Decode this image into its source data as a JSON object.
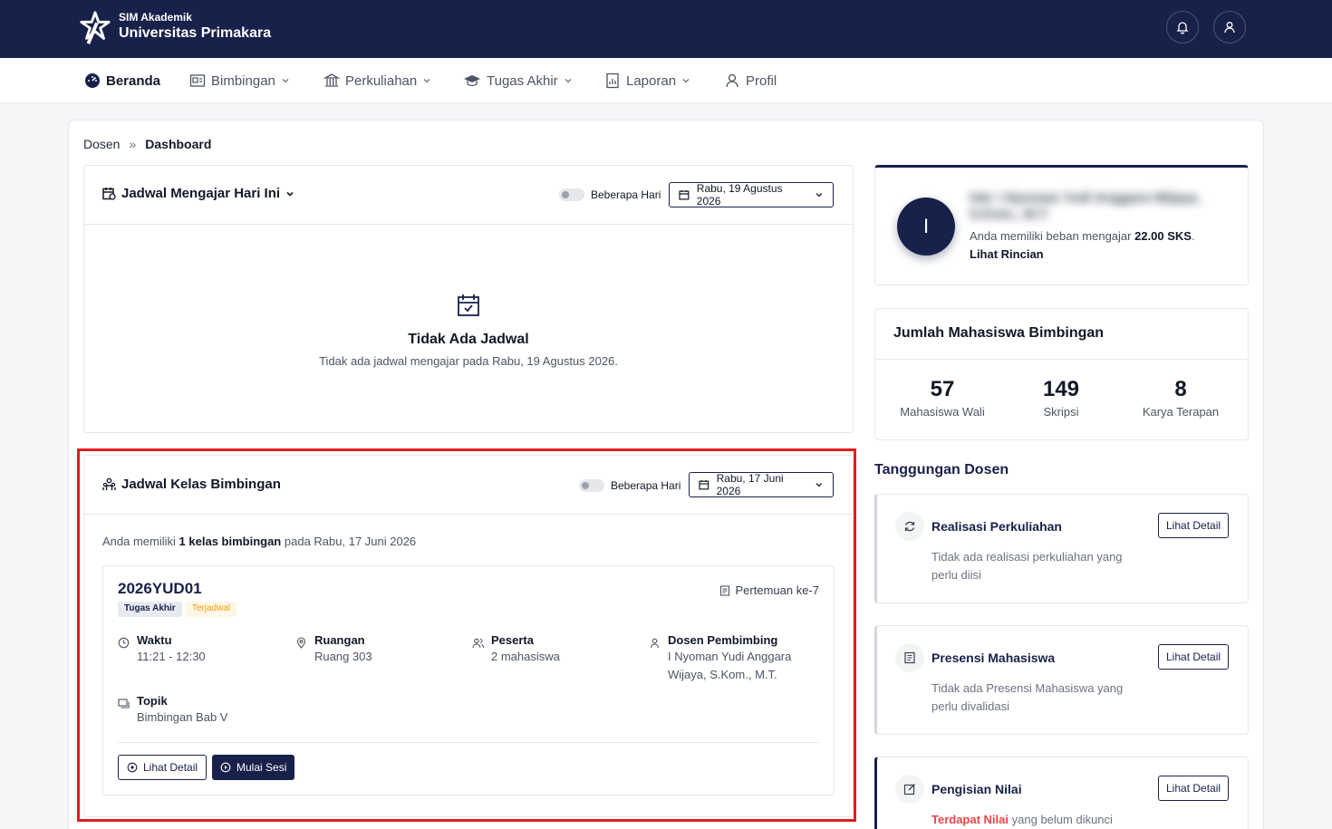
{
  "header": {
    "brand_sub": "SIM Akademik",
    "brand_main": "Universitas Primakara"
  },
  "nav": {
    "items": [
      {
        "label": "Beranda",
        "icon": "dashboard-icon",
        "active": true
      },
      {
        "label": "Bimbingan",
        "icon": "guidance-icon"
      },
      {
        "label": "Perkuliahan",
        "icon": "building-icon"
      },
      {
        "label": "Tugas Akhir",
        "icon": "graduation-cap-icon"
      },
      {
        "label": "Laporan",
        "icon": "report-icon"
      },
      {
        "label": "Profil",
        "icon": "user-icon"
      }
    ]
  },
  "breadcrumb": {
    "root": "Dosen",
    "separator": "»",
    "current": "Dashboard"
  },
  "teaching_schedule": {
    "title": "Jadwal Mengajar Hari Ini",
    "toggle_label": "Beberapa Hari",
    "date": "Rabu, 19 Agustus 2026",
    "empty_title": "Tidak Ada Jadwal",
    "empty_desc": "Tidak ada jadwal mengajar pada Rabu, 19 Agustus 2026."
  },
  "guidance_schedule": {
    "title": "Jadwal Kelas Bimbingan",
    "toggle_label": "Beberapa Hari",
    "date": "Rabu, 17 Juni 2026",
    "summary_prefix": "Anda memiliki",
    "summary_count": "1 kelas bimbingan",
    "summary_suffix": "pada Rabu, 17 Juni 2026",
    "class": {
      "code": "2026YUD01",
      "badge_type": "Tugas Akhir",
      "badge_status": "Terjadwal",
      "meeting": "Pertemuan ke-7",
      "time_label": "Waktu",
      "time_value": "11:21 - 12:30",
      "room_label": "Ruangan",
      "room_value": "Ruang 303",
      "participants_label": "Peserta",
      "participants_value": "2 mahasiswa",
      "supervisor_label": "Dosen Pembimbing",
      "supervisor_value_line1": "I Nyoman Yudi Anggara",
      "supervisor_value_line2": "Wijaya, S.Kom., M.T.",
      "topic_label": "Topik",
      "topic_value": "Bimbingan Bab V",
      "detail_button": "Lihat Detail",
      "start_button": "Mulai Sesi"
    }
  },
  "profile": {
    "avatar_initial": "I",
    "name_blurred": "Hal. I Nyoman Yudi Anggara Wijaya, S.Kom., M.T.",
    "load_prefix": "Anda memiliki beban mengajar",
    "load_value": "22.00 SKS",
    "load_suffix": ".",
    "detail_link": "Lihat Rincian"
  },
  "students": {
    "title": "Jumlah Mahasiswa Bimbingan",
    "stats": [
      {
        "value": "57",
        "label": "Mahasiswa Wali"
      },
      {
        "value": "149",
        "label": "Skripsi"
      },
      {
        "value": "8",
        "label": "Karya Terapan"
      }
    ]
  },
  "responsibilities": {
    "title": "Tanggungan Dosen",
    "items": [
      {
        "title": "Realisasi Perkuliahan",
        "desc": "Tidak ada realisasi perkuliahan yang perlu diisi",
        "button": "Lihat Detail",
        "icon": "refresh-icon"
      },
      {
        "title": "Presensi Mahasiswa",
        "desc": "Tidak ada Presensi Mahasiswa yang perlu divalidasi",
        "button": "Lihat Detail",
        "icon": "document-icon"
      },
      {
        "title": "Pengisian Nilai",
        "desc_highlight": "Terdapat Nilai",
        "desc": "yang belum dikunci",
        "button": "Lihat Detail",
        "icon": "edit-icon"
      }
    ]
  },
  "colors": {
    "primary": "#18214a",
    "highlight_border": "#e11d1d",
    "warning": "#f59e0b",
    "danger": "#ef4444"
  }
}
